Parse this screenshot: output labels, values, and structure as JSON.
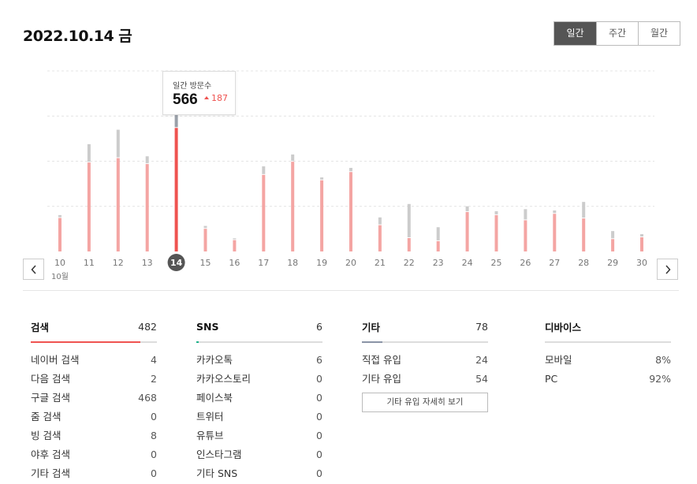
{
  "header": {
    "date": "2022.10.14 금"
  },
  "period_tabs": [
    {
      "label": "일간",
      "active": true
    },
    {
      "label": "주간",
      "active": false
    },
    {
      "label": "월간",
      "active": false
    }
  ],
  "chart_data": {
    "type": "bar",
    "title": "",
    "categories": [
      "10",
      "11",
      "12",
      "13",
      "14",
      "15",
      "16",
      "17",
      "18",
      "19",
      "20",
      "21",
      "22",
      "23",
      "24",
      "25",
      "26",
      "27",
      "28",
      "29",
      "30"
    ],
    "month_label": "10월",
    "selected_category": "14",
    "series": [
      {
        "color": "#f4a5a3",
        "selected_color": "#ef5350",
        "values": [
          130,
          345,
          362,
          339,
          479,
          88,
          44,
          297,
          348,
          276,
          308,
          102,
          52,
          40,
          153,
          141,
          121,
          146,
          128,
          48,
          55
        ]
      },
      {
        "color": "#cccccc",
        "selected_color": "#9aa0a8",
        "values": [
          8,
          68,
          107,
          27,
          87,
          8,
          4,
          30,
          25,
          8,
          13,
          27,
          129,
          51,
          19,
          12,
          40,
          10,
          61,
          28,
          9
        ]
      }
    ],
    "ylim": [
      0,
      700
    ],
    "grid": true,
    "colors": {
      "bar_primary": "#f4a5a3",
      "bar_secondary": "#cccccc",
      "bar_selected": "#ef5350",
      "bar_selected_secondary": "#9aa0a8",
      "selected_badge": "#555555"
    }
  },
  "tooltip": {
    "label": "일간 방문수",
    "value": "566",
    "delta": "187",
    "delta_color": "#ef5350"
  },
  "panels": [
    {
      "id": "search",
      "name": "검색",
      "total": "482",
      "bar_color": "#ef5350",
      "bar_fraction": 0.87,
      "rows": [
        {
          "label": "네이버 검색",
          "value": "4"
        },
        {
          "label": "다음 검색",
          "value": "2"
        },
        {
          "label": "구글 검색",
          "value": "468"
        },
        {
          "label": "줌 검색",
          "value": "0"
        },
        {
          "label": "빙 검색",
          "value": "8"
        },
        {
          "label": "야후 검색",
          "value": "0"
        },
        {
          "label": "기타 검색",
          "value": "0"
        }
      ]
    },
    {
      "id": "sns",
      "name": "SNS",
      "total": "6",
      "bar_color": "#1fb28a",
      "bar_fraction": 0.02,
      "rows": [
        {
          "label": "카카오톡",
          "value": "6"
        },
        {
          "label": "카카오스토리",
          "value": "0"
        },
        {
          "label": "페이스북",
          "value": "0"
        },
        {
          "label": "트위터",
          "value": "0"
        },
        {
          "label": "유튜브",
          "value": "0"
        },
        {
          "label": "인스타그램",
          "value": "0"
        },
        {
          "label": "기타 SNS",
          "value": "0"
        }
      ]
    },
    {
      "id": "etc",
      "name": "기타",
      "total": "78",
      "bar_color": "#8a94a6",
      "bar_fraction": 0.16,
      "rows": [
        {
          "label": "직접 유입",
          "value": "24"
        },
        {
          "label": "기타 유입",
          "value": "54"
        }
      ],
      "button": "기타 유입 자세히 보기"
    },
    {
      "id": "device",
      "name": "디바이스",
      "total": "",
      "bar_color": "#dddddd",
      "bar_fraction": 0,
      "rows": [
        {
          "label": "모바일",
          "value": "8%"
        },
        {
          "label": "PC",
          "value": "92%"
        }
      ]
    }
  ]
}
